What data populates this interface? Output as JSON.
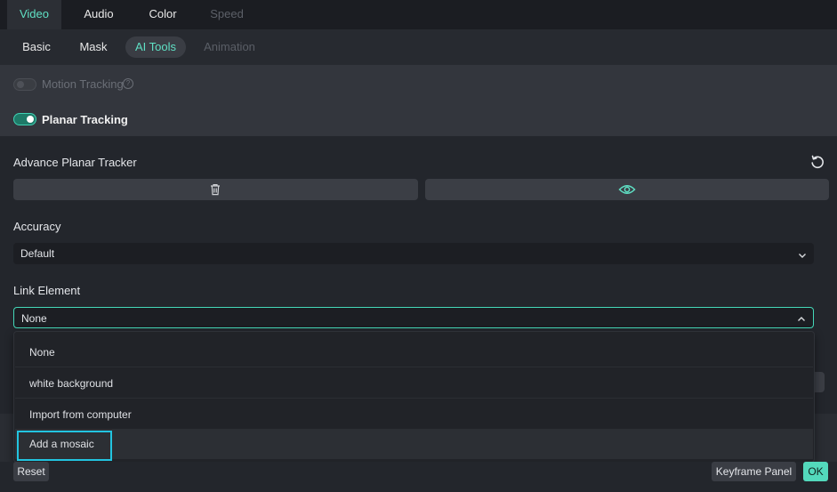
{
  "top_tabs": [
    {
      "label": "Video",
      "state": "active"
    },
    {
      "label": "Audio",
      "state": "normal"
    },
    {
      "label": "Color",
      "state": "normal"
    },
    {
      "label": "Speed",
      "state": "disabled"
    }
  ],
  "sub_tabs": [
    {
      "label": "Basic",
      "state": "normal"
    },
    {
      "label": "Mask",
      "state": "normal"
    },
    {
      "label": "AI Tools",
      "state": "active"
    },
    {
      "label": "Animation",
      "state": "disabled"
    }
  ],
  "tracking": {
    "motion_label": "Motion Tracking",
    "motion_enabled": false,
    "help_glyph": "?",
    "planar_label": "Planar Tracking",
    "planar_enabled": true
  },
  "advanced": {
    "title": "Advance Planar Tracker",
    "reset_icon": "reset-icon",
    "delete_icon": "trash-icon",
    "view_icon": "eye-icon"
  },
  "accuracy": {
    "label": "Accuracy",
    "value": "Default"
  },
  "link_element": {
    "label": "Link Element",
    "value": "None",
    "options": [
      "None",
      "white background",
      "Import from computer",
      "Add a mosaic"
    ],
    "hovered": "Add a mosaic"
  },
  "footer": {
    "reset": "Reset",
    "keyframe_panel": "Keyframe Panel",
    "ok": "OK"
  },
  "colors": {
    "accent": "#5fe0c4",
    "highlight": "#22c4e0",
    "ok_bg": "#53d9bc"
  }
}
